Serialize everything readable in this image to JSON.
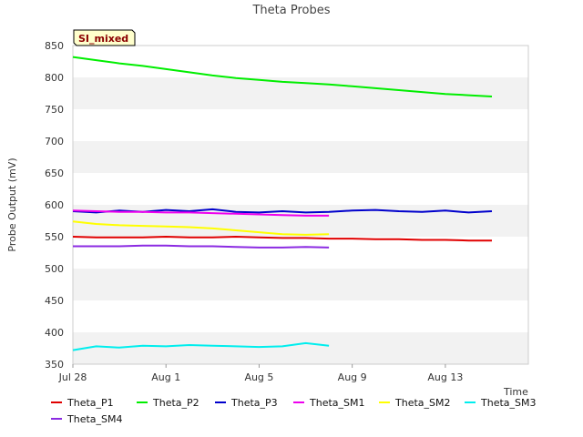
{
  "chart_data": {
    "type": "line",
    "title": "Theta Probes",
    "badge": "SI_mixed",
    "xlabel": "Time",
    "ylabel": "Probe Output (mV)",
    "ylim": [
      350,
      850
    ],
    "yticks": [
      350,
      400,
      450,
      500,
      550,
      600,
      650,
      700,
      750,
      800,
      850
    ],
    "xlim": [
      "2023-07-28",
      "2023-08-15"
    ],
    "xticks": [
      {
        "label": "Jul 28",
        "date": "2023-07-28"
      },
      {
        "label": "Aug 1",
        "date": "2023-08-01"
      },
      {
        "label": "Aug 5",
        "date": "2023-08-05"
      },
      {
        "label": "Aug 9",
        "date": "2023-08-09"
      },
      {
        "label": "Aug 13",
        "date": "2023-08-13"
      }
    ],
    "grid": true,
    "legend_position": "bottom",
    "series": [
      {
        "name": "Theta_P1",
        "color": "#e00000",
        "x": [
          "2023-07-28",
          "2023-07-29",
          "2023-07-30",
          "2023-07-31",
          "2023-08-01",
          "2023-08-02",
          "2023-08-03",
          "2023-08-04",
          "2023-08-05",
          "2023-08-06",
          "2023-08-07",
          "2023-08-08",
          "2023-08-09",
          "2023-08-10",
          "2023-08-11",
          "2023-08-12",
          "2023-08-13",
          "2023-08-14",
          "2023-08-15"
        ],
        "values": [
          550,
          549,
          549,
          549,
          550,
          549,
          549,
          550,
          549,
          548,
          548,
          547,
          547,
          546,
          546,
          545,
          545,
          544,
          544
        ]
      },
      {
        "name": "Theta_P2",
        "color": "#00ee00",
        "x": [
          "2023-07-28",
          "2023-07-29",
          "2023-07-30",
          "2023-07-31",
          "2023-08-01",
          "2023-08-02",
          "2023-08-03",
          "2023-08-04",
          "2023-08-05",
          "2023-08-06",
          "2023-08-07",
          "2023-08-08",
          "2023-08-09",
          "2023-08-10",
          "2023-08-11",
          "2023-08-12",
          "2023-08-13",
          "2023-08-14",
          "2023-08-15"
        ],
        "values": [
          832,
          827,
          822,
          818,
          813,
          808,
          803,
          799,
          796,
          793,
          791,
          789,
          786,
          783,
          780,
          777,
          774,
          772,
          770
        ]
      },
      {
        "name": "Theta_P3",
        "color": "#0000cc",
        "x": [
          "2023-07-28",
          "2023-07-29",
          "2023-07-30",
          "2023-07-31",
          "2023-08-01",
          "2023-08-02",
          "2023-08-03",
          "2023-08-04",
          "2023-08-05",
          "2023-08-06",
          "2023-08-07",
          "2023-08-08",
          "2023-08-09",
          "2023-08-10",
          "2023-08-11",
          "2023-08-12",
          "2023-08-13",
          "2023-08-14",
          "2023-08-15"
        ],
        "values": [
          590,
          588,
          591,
          589,
          592,
          590,
          593,
          589,
          588,
          590,
          588,
          589,
          591,
          592,
          590,
          589,
          591,
          588,
          590
        ]
      },
      {
        "name": "Theta_SM1",
        "color": "#ee00ee",
        "x": [
          "2023-07-28",
          "2023-07-29",
          "2023-07-30",
          "2023-07-31",
          "2023-08-01",
          "2023-08-02",
          "2023-08-03",
          "2023-08-04",
          "2023-08-05",
          "2023-08-06",
          "2023-08-07",
          "2023-08-08"
        ],
        "values": [
          591,
          590,
          589,
          589,
          588,
          588,
          587,
          586,
          585,
          584,
          583,
          583
        ]
      },
      {
        "name": "Theta_SM2",
        "color": "#ffff00",
        "x": [
          "2023-07-28",
          "2023-07-29",
          "2023-07-30",
          "2023-07-31",
          "2023-08-01",
          "2023-08-02",
          "2023-08-03",
          "2023-08-04",
          "2023-08-05",
          "2023-08-06",
          "2023-08-07",
          "2023-08-08"
        ],
        "values": [
          574,
          570,
          568,
          567,
          566,
          565,
          563,
          560,
          557,
          554,
          553,
          554
        ]
      },
      {
        "name": "Theta_SM3",
        "color": "#00eeee",
        "x": [
          "2023-07-28",
          "2023-07-29",
          "2023-07-30",
          "2023-07-31",
          "2023-08-01",
          "2023-08-02",
          "2023-08-03",
          "2023-08-04",
          "2023-08-05",
          "2023-08-06",
          "2023-08-07",
          "2023-08-08"
        ],
        "values": [
          372,
          378,
          376,
          379,
          378,
          380,
          379,
          378,
          377,
          378,
          383,
          379
        ]
      },
      {
        "name": "Theta_SM4",
        "color": "#8b2be2",
        "x": [
          "2023-07-28",
          "2023-07-29",
          "2023-07-30",
          "2023-07-31",
          "2023-08-01",
          "2023-08-02",
          "2023-08-03",
          "2023-08-04",
          "2023-08-05",
          "2023-08-06",
          "2023-08-07",
          "2023-08-08"
        ],
        "values": [
          535,
          535,
          535,
          536,
          536,
          535,
          535,
          534,
          533,
          533,
          534,
          533
        ]
      }
    ]
  }
}
